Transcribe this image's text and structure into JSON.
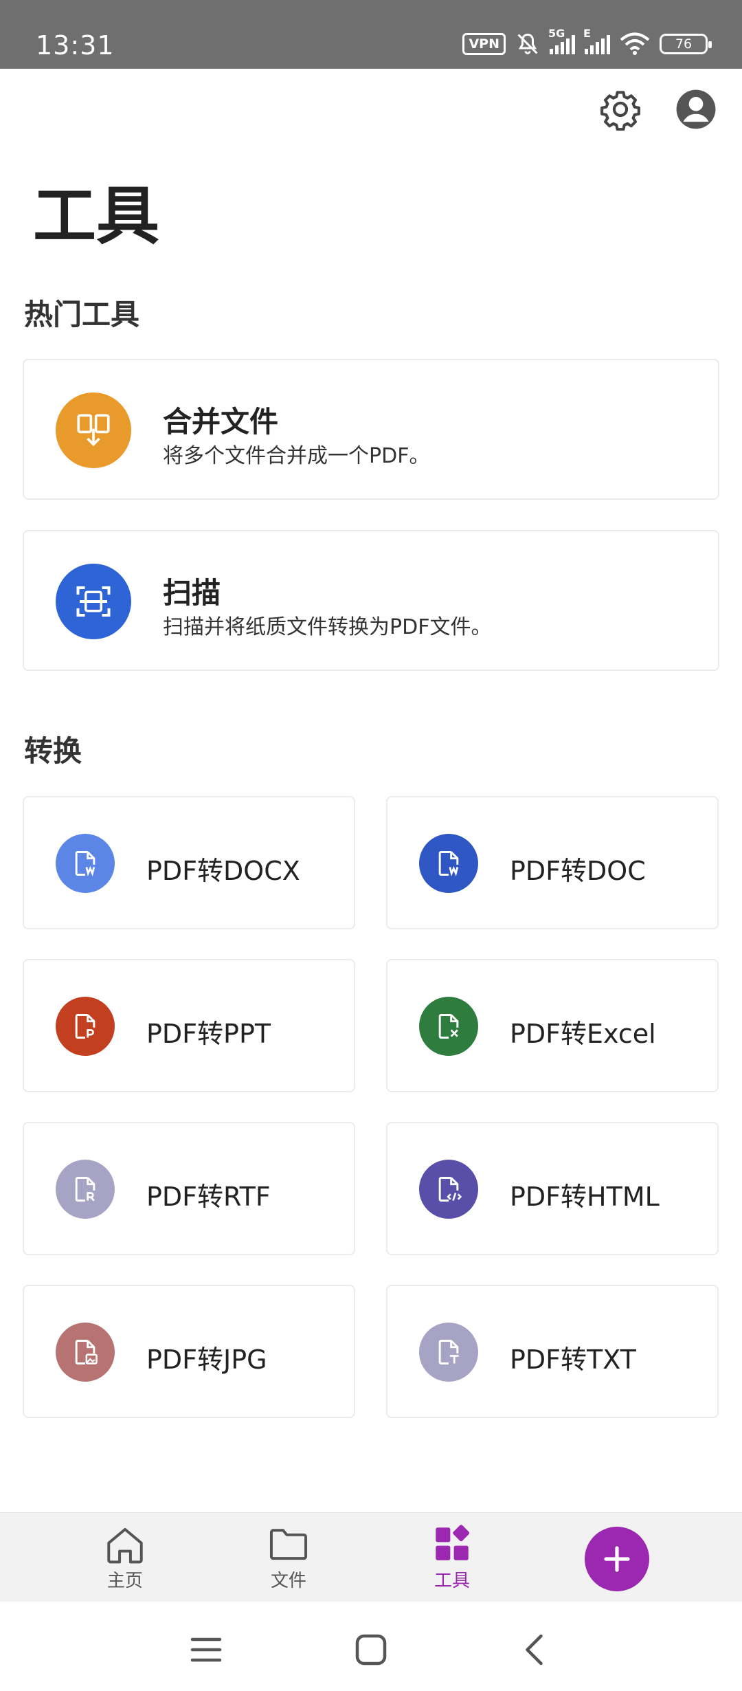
{
  "status_bar": {
    "time": "13:31",
    "vpn": "VPN",
    "network1": "5G",
    "network2": "E",
    "battery": "76"
  },
  "header": {
    "settings_icon": "gear-icon",
    "profile_icon": "account-circle-icon"
  },
  "page": {
    "title": "工具"
  },
  "hot_tools": {
    "heading": "热门工具",
    "items": [
      {
        "title": "合并文件",
        "desc": "将多个文件合并成一个PDF。",
        "icon": "merge-files-icon",
        "color": "#e89a2b"
      },
      {
        "title": "扫描",
        "desc": "扫描并将纸质文件转换为PDF文件。",
        "icon": "scan-icon",
        "color": "#2e64d6"
      }
    ]
  },
  "convert": {
    "heading": "转换",
    "items": [
      {
        "label": "PDF转DOCX",
        "icon": "docx-icon",
        "color": "#5b86e5"
      },
      {
        "label": "PDF转DOC",
        "icon": "doc-icon",
        "color": "#2f57c4"
      },
      {
        "label": "PDF转PPT",
        "icon": "ppt-icon",
        "color": "#c2401f"
      },
      {
        "label": "PDF转Excel",
        "icon": "excel-icon",
        "color": "#2e7d3f"
      },
      {
        "label": "PDF转RTF",
        "icon": "rtf-icon",
        "color": "#a6a3c4"
      },
      {
        "label": "PDF转HTML",
        "icon": "html-icon",
        "color": "#5a4fa8"
      },
      {
        "label": "PDF转JPG",
        "icon": "jpg-icon",
        "color": "#b77272"
      },
      {
        "label": "PDF转TXT",
        "icon": "txt-icon",
        "color": "#a6a3c4"
      }
    ]
  },
  "bottom_nav": {
    "items": [
      {
        "label": "主页",
        "icon": "home-icon"
      },
      {
        "label": "文件",
        "icon": "folder-icon"
      },
      {
        "label": "工具",
        "icon": "tools-grid-icon",
        "active": true
      }
    ],
    "fab_icon": "plus-icon",
    "accent": "#9c27b0"
  }
}
